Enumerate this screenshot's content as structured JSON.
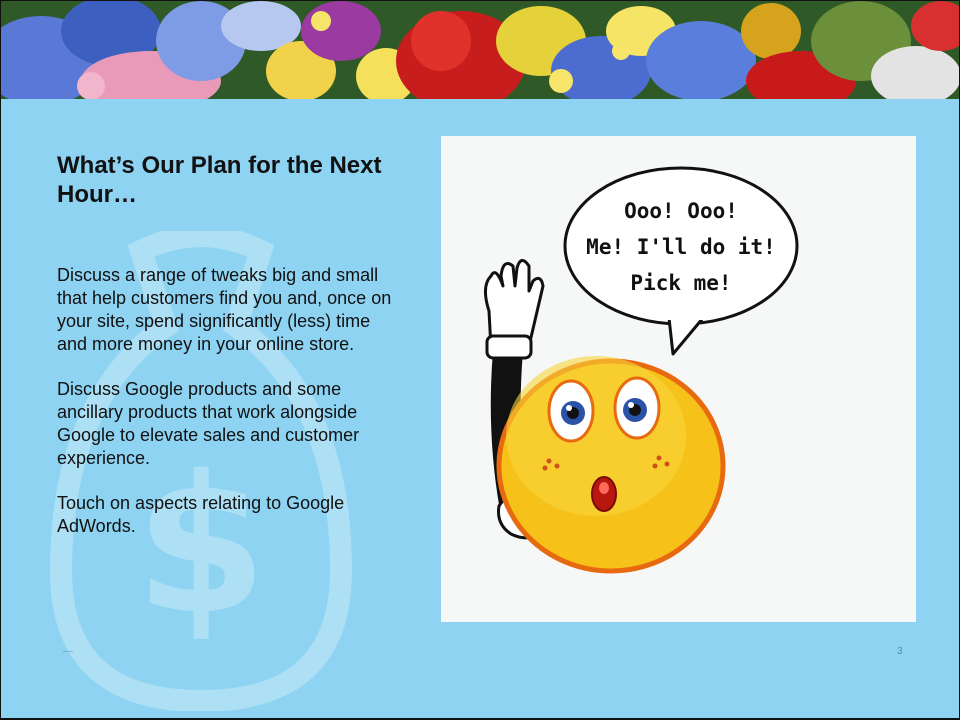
{
  "slide": {
    "title": "What’s Our Plan for the Next Hour…",
    "paragraphs": [
      "Discuss a range of tweaks big and small that help customers find you and, once on your site, spend significantly (less) time and more money in your online store.",
      "Discuss Google products and some ancillary products that work alongside Google to elevate sales and customer experience.",
      "Touch on aspects relating to Google AdWords."
    ],
    "page_number": "3",
    "footer_date": "—"
  },
  "illustration": {
    "speech_lines": [
      "Ooo! Ooo!",
      "Me! I'll do it!",
      "Pick me!"
    ],
    "icon": "raised-hand-smiley-icon"
  },
  "banner": {
    "icon": "flower-banner-image"
  },
  "colors": {
    "background": "#8ed3f2",
    "image_box": "#f6f8f8",
    "smiley": "#f6c21a"
  }
}
